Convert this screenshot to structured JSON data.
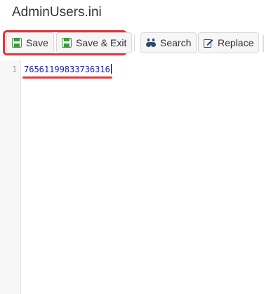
{
  "window": {
    "title": "AdminUsers.ini"
  },
  "toolbar": {
    "save_label": "Save",
    "save_exit_label": "Save & Exit",
    "search_label": "Search",
    "replace_label": "Replace"
  },
  "icons": {
    "save": "save-icon",
    "save_exit": "save-icon",
    "search": "binoculars-icon",
    "replace": "edit-icon"
  },
  "colors": {
    "highlight": "#e0363c",
    "save_icon": "#3a9a3a",
    "code_text": "#1a1aa6"
  },
  "editor": {
    "lines": [
      {
        "number": "1",
        "text": "76561199833736316"
      }
    ]
  }
}
